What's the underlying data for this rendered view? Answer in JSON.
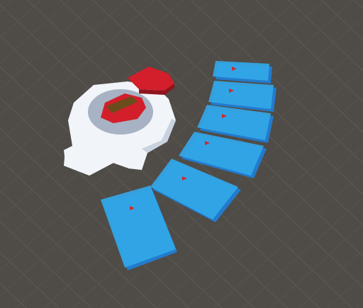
{
  "scene": {
    "background_color": "#4f4b47",
    "grid_line_color": "#5e5a55",
    "grid_line_color_dim": "#57534e",
    "disk_base_color": "#f1f4f8",
    "disk_shade_color": "#c9d3e0",
    "disk_dark_color": "#a7b3c4",
    "hub_color": "#d21f2b",
    "hub_dark_color": "#8f141d",
    "slot_color": "#6a4d1a",
    "card_front_color": "#33a7e8",
    "card_back_color": "#227bcc",
    "card_marker_color": "#d02a2a",
    "card_count": 6
  }
}
